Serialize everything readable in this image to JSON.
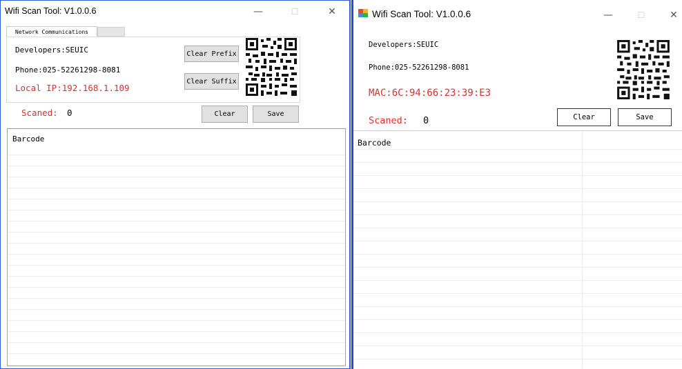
{
  "left_window": {
    "title": "Wifi Scan Tool:  V1.0.0.6",
    "tabs": [
      {
        "label": "Network Communications",
        "active": true
      },
      {
        "label": "",
        "active": false
      }
    ],
    "developers": "Developers:SEUIC",
    "phone": "Phone:025-52261298-8081",
    "local_ip": "Local IP:192.168.1.109",
    "clear_prefix_label": "Clear Prefix",
    "clear_suffix_label": "Clear Suffix",
    "scanned_label": "Scaned:",
    "scanned_count": "0",
    "clear_label": "Clear",
    "save_label": "Save",
    "grid_header": "Barcode"
  },
  "right_window": {
    "title": "Wifi Scan Tool:  V1.0.0.6",
    "developers": "Developers:SEUIC",
    "phone": "Phone:025-52261298-8081",
    "mac": "MAC:6C:94:66:23:39:E3",
    "scanned_label": "Scaned:",
    "scanned_count": "0",
    "clear_label": "Clear",
    "save_label": "Save",
    "grid_header": "Barcode"
  },
  "window_controls": {
    "minimize": "—",
    "maximize": "☐",
    "close": "✕"
  },
  "colors": {
    "accent_red": "#e0302b",
    "window_border": "#2f5bd8",
    "button_face": "#e1e1e1"
  },
  "icons": {
    "qr_code": "qr-code-icon",
    "app": "app-icon"
  }
}
